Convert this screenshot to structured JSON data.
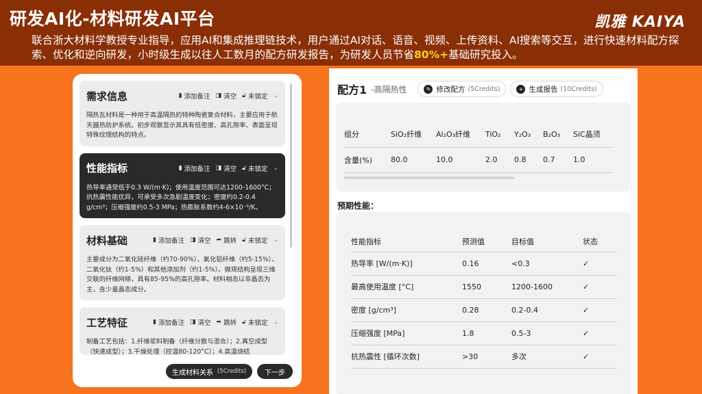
{
  "header": {
    "title": "研发AI化-材料研发AI平台",
    "brand": "凯雅 KAIYA",
    "desc_before": "联合浙大材料学教授专业指导，应用AI和集成推理链技术，用户通过AI对话、语音、视频、上传资料、AI搜索等交互，进行快速材料配方探索、优化和逆向研发，小时级生成以往人工数月的配方研发报告，为研发人员节省",
    "desc_highlight": "80%+",
    "desc_after": "基础研究投入。"
  },
  "actions": {
    "add_note": "添加备注",
    "clear": "清空",
    "unlocked": "未锁定",
    "jump": "跳转"
  },
  "cards": [
    {
      "title": "需求信息",
      "body": "隔热瓦材料是一种用于高温隔热的特种陶瓷复合材料，主要应用于航天器热防护系统。初步观察显示其具有低密度、高孔隙率、表面呈现特殊纹理结构的特点。"
    },
    {
      "title": "性能指标",
      "body": "热导率通常低于0.3 W/(m·K)；使用温度范围可达1200-1600°C；抗热震性能优异，可承受多次急剧温度变化；密度约0.2-0.4 g/cm³；压缩强度约0.5-3 MPa；热膨胀系数约4-6×10⁻⁶/K。"
    },
    {
      "title": "材料基础",
      "body": "主要成分为二氧化硅纤维（约70-90%）、氧化铝纤维（约5-15%）、二氧化钛（约1-5%）和其他添加剂（约1-5%）。微观结构呈现三维交联的纤维网络，具有85-95%的高孔隙率。材料相态以非晶态为主，含少量晶态成分。"
    },
    {
      "title": "工艺特征",
      "body": "制备工艺包括：1.纤维浆料制备（纤维分散与混合）；2.真空成型（快速成型）；3.干燥处理（控温80-120°C）；4.高温烧结"
    }
  ],
  "left_footer": {
    "gen_relation": "生成材料关系",
    "gen_relation_credits": "(5Credits)",
    "next": "下一步"
  },
  "formula": {
    "title": "配方1",
    "subtitle": "-高隔热性",
    "modify": "修改配方",
    "modify_credits": "(5Credits)",
    "report": "生成报告",
    "report_credits": "(10Credits)"
  },
  "composition": {
    "headers": [
      "组分",
      "SiO₂纤维",
      "Al₂O₃纤维",
      "TiO₂",
      "Y₂O₃",
      "B₂O₃",
      "SiC晶须"
    ],
    "row": [
      "含量(%)",
      "80.0",
      "10.0",
      "2.0",
      "0.8",
      "0.7",
      "1.0"
    ]
  },
  "performance": {
    "label": "预期性能：",
    "headers": [
      "性能指标",
      "预测值",
      "目标值",
      "状态"
    ],
    "rows": [
      [
        "热导率 [W/(m·K)]",
        "0.16",
        "<0.3",
        "✓"
      ],
      [
        "最高使用温度 [°C]",
        "1550",
        "1200-1600",
        "✓"
      ],
      [
        "密度 [g/cm³]",
        "0.28",
        "0.2-0.4",
        "✓"
      ],
      [
        "压缩强度 [MPa]",
        "1.8",
        "0.5-3",
        "✓"
      ],
      [
        "抗热震性 [循环次数]",
        ">30",
        "多次",
        "✓"
      ]
    ]
  },
  "icons": {
    "note": "note-icon",
    "clear": "eraser-icon",
    "lock": "unlock-icon",
    "jump": "share-arrow-icon",
    "chevron": "chevron-down-icon",
    "edit": "edit-icon",
    "plus": "plus-icon"
  },
  "colors": {
    "background": "#f7731e",
    "header": "#8a2e06",
    "highlight": "#ffd21e",
    "dark_card": "#2a2a2c"
  }
}
